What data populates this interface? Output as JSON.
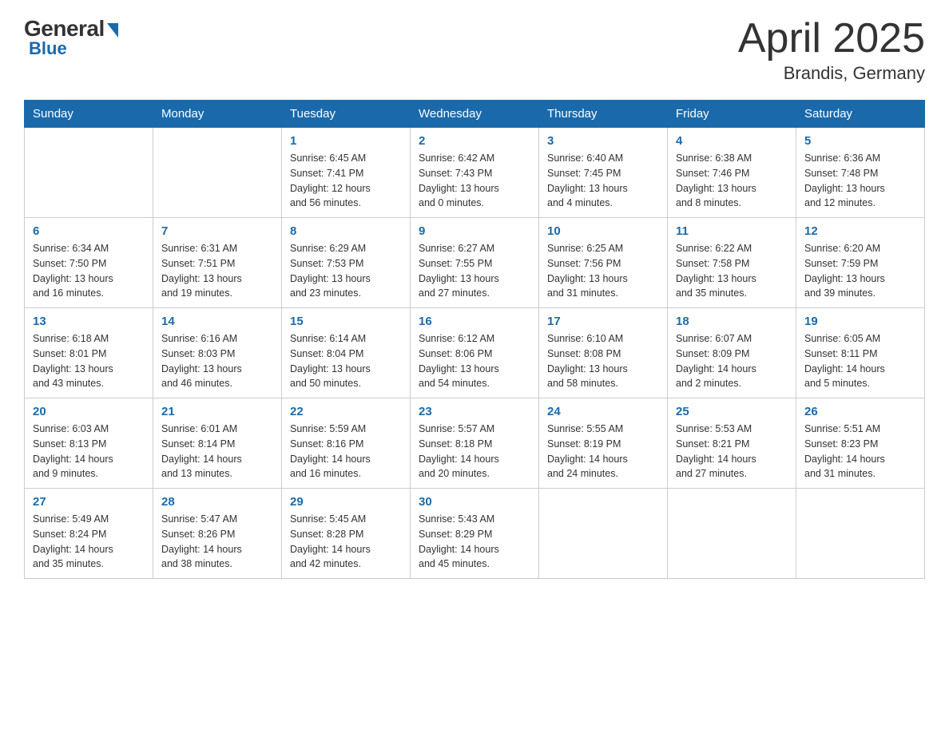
{
  "header": {
    "logo": {
      "general": "General",
      "blue": "Blue"
    },
    "title": "April 2025",
    "location": "Brandis, Germany"
  },
  "weekdays": [
    "Sunday",
    "Monday",
    "Tuesday",
    "Wednesday",
    "Thursday",
    "Friday",
    "Saturday"
  ],
  "weeks": [
    [
      {
        "day": "",
        "info": ""
      },
      {
        "day": "",
        "info": ""
      },
      {
        "day": "1",
        "info": "Sunrise: 6:45 AM\nSunset: 7:41 PM\nDaylight: 12 hours\nand 56 minutes."
      },
      {
        "day": "2",
        "info": "Sunrise: 6:42 AM\nSunset: 7:43 PM\nDaylight: 13 hours\nand 0 minutes."
      },
      {
        "day": "3",
        "info": "Sunrise: 6:40 AM\nSunset: 7:45 PM\nDaylight: 13 hours\nand 4 minutes."
      },
      {
        "day": "4",
        "info": "Sunrise: 6:38 AM\nSunset: 7:46 PM\nDaylight: 13 hours\nand 8 minutes."
      },
      {
        "day": "5",
        "info": "Sunrise: 6:36 AM\nSunset: 7:48 PM\nDaylight: 13 hours\nand 12 minutes."
      }
    ],
    [
      {
        "day": "6",
        "info": "Sunrise: 6:34 AM\nSunset: 7:50 PM\nDaylight: 13 hours\nand 16 minutes."
      },
      {
        "day": "7",
        "info": "Sunrise: 6:31 AM\nSunset: 7:51 PM\nDaylight: 13 hours\nand 19 minutes."
      },
      {
        "day": "8",
        "info": "Sunrise: 6:29 AM\nSunset: 7:53 PM\nDaylight: 13 hours\nand 23 minutes."
      },
      {
        "day": "9",
        "info": "Sunrise: 6:27 AM\nSunset: 7:55 PM\nDaylight: 13 hours\nand 27 minutes."
      },
      {
        "day": "10",
        "info": "Sunrise: 6:25 AM\nSunset: 7:56 PM\nDaylight: 13 hours\nand 31 minutes."
      },
      {
        "day": "11",
        "info": "Sunrise: 6:22 AM\nSunset: 7:58 PM\nDaylight: 13 hours\nand 35 minutes."
      },
      {
        "day": "12",
        "info": "Sunrise: 6:20 AM\nSunset: 7:59 PM\nDaylight: 13 hours\nand 39 minutes."
      }
    ],
    [
      {
        "day": "13",
        "info": "Sunrise: 6:18 AM\nSunset: 8:01 PM\nDaylight: 13 hours\nand 43 minutes."
      },
      {
        "day": "14",
        "info": "Sunrise: 6:16 AM\nSunset: 8:03 PM\nDaylight: 13 hours\nand 46 minutes."
      },
      {
        "day": "15",
        "info": "Sunrise: 6:14 AM\nSunset: 8:04 PM\nDaylight: 13 hours\nand 50 minutes."
      },
      {
        "day": "16",
        "info": "Sunrise: 6:12 AM\nSunset: 8:06 PM\nDaylight: 13 hours\nand 54 minutes."
      },
      {
        "day": "17",
        "info": "Sunrise: 6:10 AM\nSunset: 8:08 PM\nDaylight: 13 hours\nand 58 minutes."
      },
      {
        "day": "18",
        "info": "Sunrise: 6:07 AM\nSunset: 8:09 PM\nDaylight: 14 hours\nand 2 minutes."
      },
      {
        "day": "19",
        "info": "Sunrise: 6:05 AM\nSunset: 8:11 PM\nDaylight: 14 hours\nand 5 minutes."
      }
    ],
    [
      {
        "day": "20",
        "info": "Sunrise: 6:03 AM\nSunset: 8:13 PM\nDaylight: 14 hours\nand 9 minutes."
      },
      {
        "day": "21",
        "info": "Sunrise: 6:01 AM\nSunset: 8:14 PM\nDaylight: 14 hours\nand 13 minutes."
      },
      {
        "day": "22",
        "info": "Sunrise: 5:59 AM\nSunset: 8:16 PM\nDaylight: 14 hours\nand 16 minutes."
      },
      {
        "day": "23",
        "info": "Sunrise: 5:57 AM\nSunset: 8:18 PM\nDaylight: 14 hours\nand 20 minutes."
      },
      {
        "day": "24",
        "info": "Sunrise: 5:55 AM\nSunset: 8:19 PM\nDaylight: 14 hours\nand 24 minutes."
      },
      {
        "day": "25",
        "info": "Sunrise: 5:53 AM\nSunset: 8:21 PM\nDaylight: 14 hours\nand 27 minutes."
      },
      {
        "day": "26",
        "info": "Sunrise: 5:51 AM\nSunset: 8:23 PM\nDaylight: 14 hours\nand 31 minutes."
      }
    ],
    [
      {
        "day": "27",
        "info": "Sunrise: 5:49 AM\nSunset: 8:24 PM\nDaylight: 14 hours\nand 35 minutes."
      },
      {
        "day": "28",
        "info": "Sunrise: 5:47 AM\nSunset: 8:26 PM\nDaylight: 14 hours\nand 38 minutes."
      },
      {
        "day": "29",
        "info": "Sunrise: 5:45 AM\nSunset: 8:28 PM\nDaylight: 14 hours\nand 42 minutes."
      },
      {
        "day": "30",
        "info": "Sunrise: 5:43 AM\nSunset: 8:29 PM\nDaylight: 14 hours\nand 45 minutes."
      },
      {
        "day": "",
        "info": ""
      },
      {
        "day": "",
        "info": ""
      },
      {
        "day": "",
        "info": ""
      }
    ]
  ]
}
